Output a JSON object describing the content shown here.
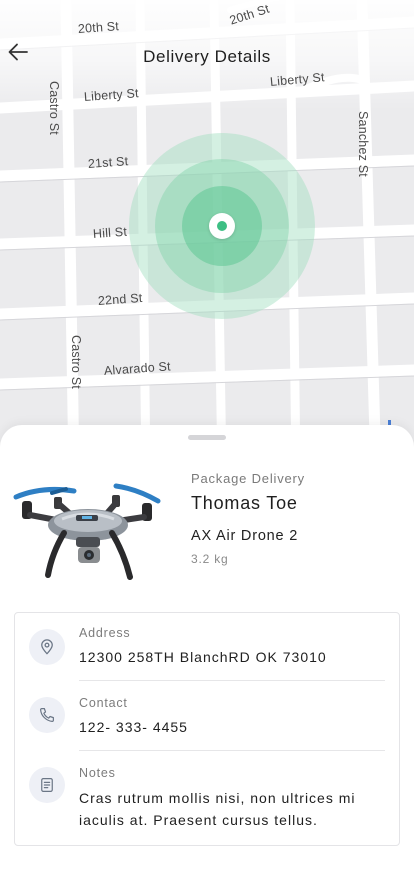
{
  "header": {
    "title": "Delivery Details"
  },
  "map": {
    "streets": {
      "st_20th_left": "20th St",
      "st_20th_right": "20th St",
      "liberty_left": "Liberty St",
      "liberty_right": "Liberty St",
      "castro_top": "Castro St",
      "castro_bottom": "Castro St",
      "sanchez": "Sanchez St",
      "st_21st": "21st St",
      "hill": "Hill St",
      "st_22nd": "22nd St",
      "alvarado": "Alvarado St"
    },
    "accent_color": "#3dbf84"
  },
  "package": {
    "type": "Package Delivery",
    "recipient": "Thomas Toe",
    "model": "AX Air Drone 2",
    "weight": "3.2 kg"
  },
  "details": {
    "address": {
      "label": "Address",
      "value": "12300 258TH BlanchRD OK 73010",
      "icon": "location-pin-icon"
    },
    "contact": {
      "label": "Contact",
      "value": "122- 333- 4455",
      "icon": "phone-icon"
    },
    "notes": {
      "label": "Notes",
      "value": "Cras rutrum mollis nisi, non ultrices mi iaculis at. Praesent cursus tellus.",
      "icon": "notes-icon"
    }
  }
}
